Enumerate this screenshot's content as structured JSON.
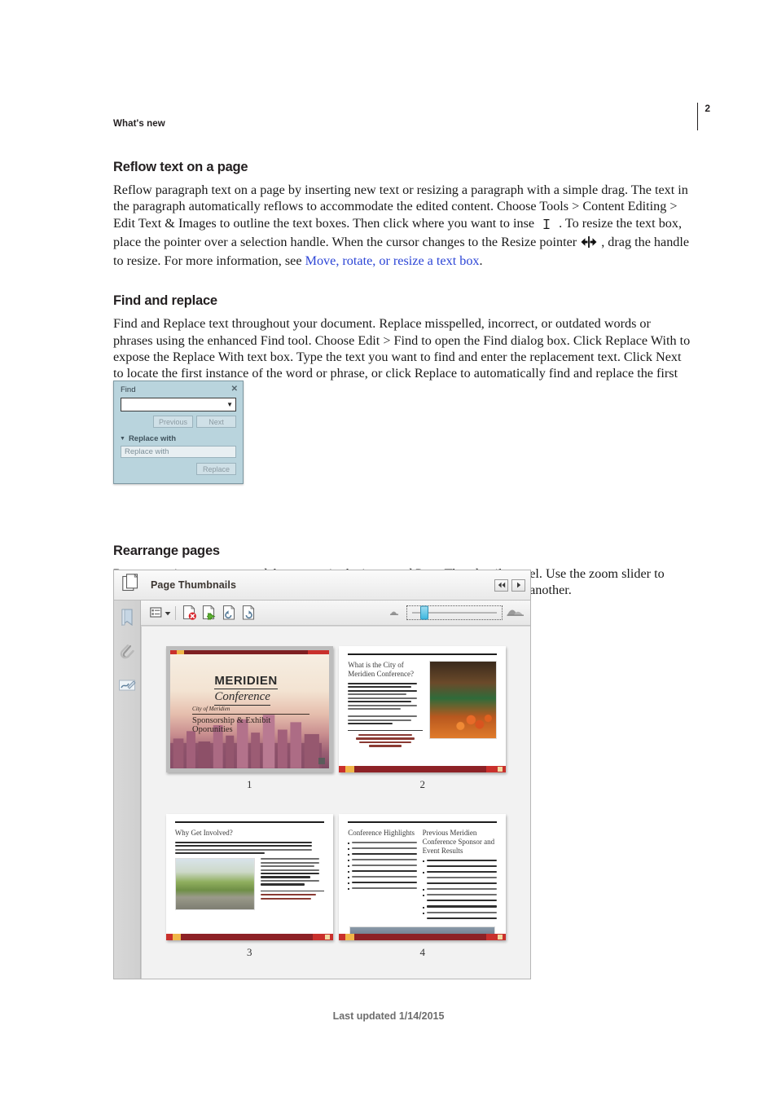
{
  "page": {
    "running_head": "What's new",
    "page_number": "2",
    "footer": "Last updated 1/14/2015"
  },
  "sections": [
    {
      "heading": "Reflow text on a page",
      "paragraph_part1": "Reflow paragraph text on a page by inserting new text or resizing a paragraph with a simple drag. The text in the paragraph automatically reflows to accommodate the edited content. Choose Tools > Content Editing > Edit Text & Images to outline the text boxes. Then click where you want to inse",
      "paragraph_part2": ". To resize the text box, place the pointer over a selection handle. When the cursor changes to the Resize pointer",
      "paragraph_part3": ", drag the handle to resize. For more information, see ",
      "link_text": "Move, rotate, or resize a text box",
      "paragraph_end": ".",
      "icon_cursor": "text-insert-cursor-icon",
      "icon_resize": "horizontal-resize-pointer-icon"
    },
    {
      "heading": "Find and replace",
      "paragraph": "Find and Replace text throughout your document. Replace misspelled, incorrect, or outdated words or phrases using the enhanced Find tool. Choose Edit > Find to open the Find dialog box. Click Replace With to expose the Replace With text box. Type the text you want to find and enter the replacement text. Click Next to locate the first instance of the word or phrase, or click Replace to automatically find and replace the first instance."
    },
    {
      "heading": "Rearrange pages",
      "paragraph": "Rearrange, insert, rotate, or delete pages in the improved Page Thumbnails panel. Use the zoom slider to adjust the size of thumbnails. Easily drag-and-drop pages from one location to another."
    }
  ],
  "find_dialog": {
    "title": "Find",
    "close_label": "✕",
    "search_value": "",
    "search_placeholder": "",
    "dropdown_arrow": "▼",
    "previous_label": "Previous",
    "next_label": "Next",
    "replace_section_label": "Replace with",
    "replace_section_triangle": "▼",
    "replace_input_value": "Replace with",
    "replace_button_label": "Replace",
    "colors": {
      "panel_bg": "#b9d4dd",
      "panel_border": "#7d98a2",
      "button_bg": "#cfe0e7",
      "disabled_text": "#8b9aa2"
    }
  },
  "thumbnails_panel": {
    "title": "Page Thumbnails",
    "panel_icon": "page-thumbnails-icon",
    "nav_prev_label": "◀◀",
    "nav_next_label": "▶",
    "rail_icons": [
      {
        "name": "bookmarks-icon"
      },
      {
        "name": "attachments-paperclip-icon"
      },
      {
        "name": "signatures-icon"
      }
    ],
    "toolbar": [
      {
        "name": "options-menu-icon",
        "label": "Options"
      },
      {
        "name": "delete-pages-icon",
        "label": "Delete Pages"
      },
      {
        "name": "insert-pages-icon",
        "label": "Insert Pages"
      },
      {
        "name": "rotate-counterclockwise-icon",
        "label": "Rotate Counterclockwise"
      },
      {
        "name": "rotate-clockwise-icon",
        "label": "Rotate Clockwise"
      }
    ],
    "zoom_slider": {
      "small_thumbnails_icon": "small-thumbnails-icon",
      "large_thumbnails_icon": "large-thumbnails-icon",
      "value_percent": 14
    },
    "thumbnails": [
      {
        "number": "1",
        "selected": true,
        "type": "cover",
        "logo_line1": "MERIDIEN",
        "logo_line2": "Conference",
        "subtitle_small": "City of Meridien",
        "subtitle_big": "Sponsorship & Exhibit Oporunities"
      },
      {
        "number": "2",
        "selected": false,
        "type": "text-photo",
        "title": "What is the City of Meridien Conference?",
        "photo": "market-photo"
      },
      {
        "number": "3",
        "selected": false,
        "type": "text-photo",
        "title": "Why Get Involved?",
        "photo": "park-promenade-photo"
      },
      {
        "number": "4",
        "selected": false,
        "type": "two-column",
        "title_left": "Conference Highlights",
        "title_right": "Previous Meridien Conference Sponsor and Event Results",
        "photo": "crowd-photo"
      }
    ]
  }
}
